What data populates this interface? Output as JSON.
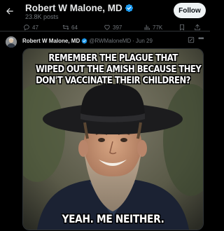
{
  "header": {
    "name": "Robert W Malone, MD",
    "post_count": "23.8K posts",
    "follow_label": "Follow"
  },
  "actions": {
    "replies": "47",
    "reposts": "64",
    "likes": "397",
    "views": "77K"
  },
  "post": {
    "author": "Robert W Malone, MD",
    "handle": "@RWMaloneMD",
    "separator": "·",
    "date": "Jun 29",
    "more_label": "•••"
  },
  "meme": {
    "top_lines": [
      "REMEMBER THE PLAGUE THAT",
      "WIPED OUT THE AMISH BECAUSE THEY",
      "DON'T VACCINATE THEIR CHILDREN?"
    ],
    "bottom_text": "YEAH. ME NEITHER."
  },
  "colors": {
    "background": "#000000",
    "text_primary": "#e7e9ea",
    "text_secondary": "#71767b",
    "verified": "#1d9bf0",
    "follow_bg": "#eff3f4"
  },
  "icons": {
    "back": "arrow-left-icon",
    "verified": "verified-badge-icon",
    "reply": "reply-icon",
    "repost": "repost-icon",
    "like": "heart-icon",
    "views": "views-chart-icon",
    "bookmark": "bookmark-icon",
    "share": "share-icon",
    "grok": "grok-icon",
    "more": "more-icon"
  }
}
